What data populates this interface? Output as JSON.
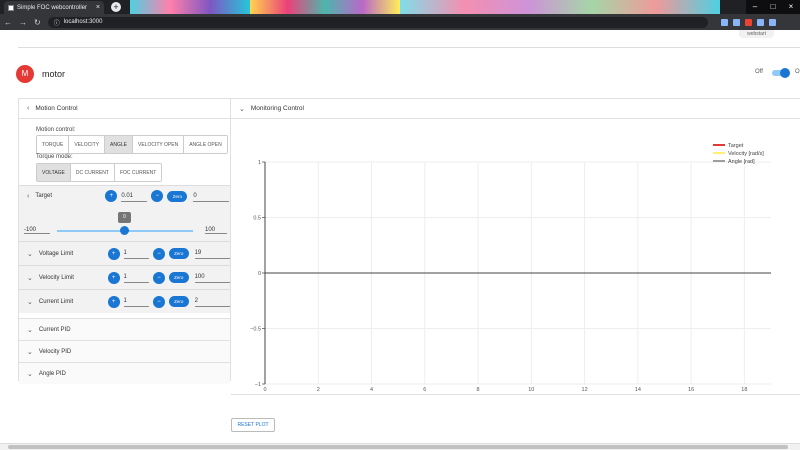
{
  "browser": {
    "tab_title": "Simple FOC webcontroller",
    "url": "localhost:3000",
    "extension_label": "webstart"
  },
  "header": {
    "avatar_letter": "M",
    "title": "motor",
    "toggle_off_label": "Off",
    "toggle_on_label": "On",
    "enabled": true
  },
  "motion_panel": {
    "title": "Motion Control",
    "motion_control_label": "Motion control:",
    "motion_modes": [
      "TORQUE",
      "VELOCITY",
      "ANGLE",
      "VELOCITY OPEN",
      "ANGLE OPEN"
    ],
    "motion_active": "ANGLE",
    "torque_mode_label": "Torque mode:",
    "torque_modes": [
      "VOLTAGE",
      "DC CURRENT",
      "FOC CURRENT"
    ],
    "torque_active": "VOLTAGE"
  },
  "target": {
    "label": "Target",
    "plus": "+",
    "step": "0.01",
    "minus": "−",
    "zero": "Zero",
    "value": "0",
    "min": "-100",
    "max": "100",
    "slider_tip": "0"
  },
  "limits": [
    {
      "label": "Voltage Limit",
      "plus": "+",
      "step": "1",
      "minus": "−",
      "zero": "Zero",
      "value": "19"
    },
    {
      "label": "Velocity Limit",
      "plus": "+",
      "step": "1",
      "minus": "−",
      "zero": "Zero",
      "value": "100"
    },
    {
      "label": "Current Limit",
      "plus": "+",
      "step": "1",
      "minus": "−",
      "zero": "Zero",
      "value": "2"
    }
  ],
  "pids": [
    "Current PID",
    "Velocity PID",
    "Angle PID"
  ],
  "monitoring": {
    "title": "Monitoring Control",
    "reset_label": "RESET PLOT"
  },
  "chart_data": {
    "type": "line",
    "title": "",
    "xlabel": "",
    "ylabel": "",
    "xlim": [
      0,
      19
    ],
    "ylim": [
      -1,
      1
    ],
    "x_ticks": [
      "0",
      "2",
      "4",
      "6",
      "8",
      "10",
      "12",
      "14",
      "16",
      "18"
    ],
    "y_ticks": [
      "1",
      "0.5",
      "0",
      "−0.5",
      "−1"
    ],
    "series": [
      {
        "name": "Target",
        "color": "#e53935",
        "values": []
      },
      {
        "name": "Velocity [rad/s]",
        "color": "#fff176",
        "values": []
      },
      {
        "name": "Angle [rad]",
        "color": "#9e9e9e",
        "values": []
      }
    ],
    "legend": "top-right",
    "grid": true
  }
}
